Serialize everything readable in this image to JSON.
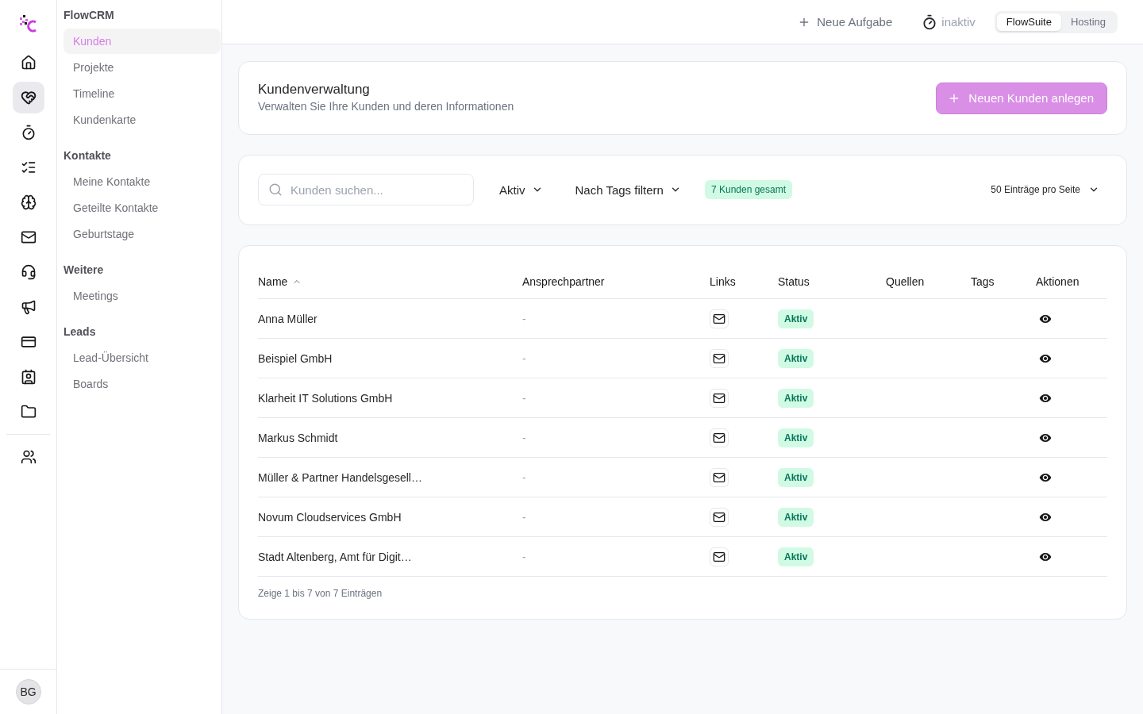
{
  "rail": {
    "items": [
      {
        "kind": "home",
        "selected": false
      },
      {
        "kind": "partners",
        "selected": true
      },
      {
        "kind": "time",
        "selected": false
      },
      {
        "kind": "tasks",
        "selected": false
      },
      {
        "kind": "ideas",
        "selected": false
      },
      {
        "kind": "mail",
        "selected": false
      },
      {
        "kind": "support",
        "selected": false
      },
      {
        "kind": "marketing",
        "selected": false
      },
      {
        "kind": "billing",
        "selected": false
      },
      {
        "kind": "contacts",
        "selected": false
      },
      {
        "kind": "files",
        "selected": false
      }
    ],
    "bottom_items": [
      {
        "kind": "team",
        "selected": false
      }
    ],
    "avatar": {
      "initials": "BG"
    }
  },
  "sidebar": {
    "sections": [
      {
        "heading": "FlowCRM",
        "items": [
          {
            "label": "Kunden",
            "selected": true
          },
          {
            "label": "Projekte",
            "selected": false
          },
          {
            "label": "Timeline",
            "selected": false
          },
          {
            "label": "Kundenkarte",
            "selected": false
          }
        ]
      },
      {
        "heading": "Kontakte",
        "items": [
          {
            "label": "Meine Kontakte",
            "selected": false
          },
          {
            "label": "Geteilte Kontakte",
            "selected": false
          },
          {
            "label": "Geburtstage",
            "selected": false
          }
        ]
      },
      {
        "heading": "Weitere",
        "items": [
          {
            "label": "Meetings",
            "selected": false
          }
        ]
      },
      {
        "heading": "Leads",
        "items": [
          {
            "label": "Lead-Übersicht",
            "selected": false
          },
          {
            "label": "Boards",
            "selected": false
          }
        ]
      }
    ]
  },
  "topbar": {
    "new_task": "Neue Aufgabe",
    "timer_status": "inaktiv",
    "workspaces": [
      {
        "label": "FlowSuite",
        "selected": true
      },
      {
        "label": "Hosting",
        "selected": false
      }
    ]
  },
  "header": {
    "title": "Kundenverwaltung",
    "subtitle": "Verwalten Sie Ihre Kunden und deren Informationen",
    "button": "Neuen Kunden anlegen"
  },
  "filters": {
    "search": {
      "placeholder": "Kunden suchen..."
    },
    "status_filter": "Aktiv",
    "tag_filter": "Nach Tags filtern",
    "count": "7 Kunden gesamt",
    "page_size": "50 Einträge pro Seite"
  },
  "table": {
    "columns": [
      {
        "label": "Name",
        "sorted": true
      },
      {
        "label": "Ansprechpartner",
        "sorted": false
      },
      {
        "label": "Links",
        "sorted": false
      },
      {
        "label": "Status",
        "sorted": false
      },
      {
        "label": "Quellen",
        "sorted": false
      },
      {
        "label": "Tags",
        "sorted": false
      },
      {
        "label": "Aktionen",
        "sorted": false
      }
    ],
    "rows": [
      {
        "name": "Anna Müller",
        "contact": "-",
        "links": [
          {
            "kind": "email"
          }
        ],
        "status": "Aktiv",
        "actions": [
          {
            "kind": "view"
          }
        ]
      },
      {
        "name": "Beispiel GmbH",
        "contact": "-",
        "links": [
          {
            "kind": "email"
          }
        ],
        "status": "Aktiv",
        "actions": [
          {
            "kind": "view"
          }
        ]
      },
      {
        "name": "Klarheit IT Solutions GmbH",
        "contact": "-",
        "links": [
          {
            "kind": "email"
          }
        ],
        "status": "Aktiv",
        "actions": [
          {
            "kind": "view"
          }
        ]
      },
      {
        "name": "Markus Schmidt",
        "contact": "-",
        "links": [
          {
            "kind": "email"
          }
        ],
        "status": "Aktiv",
        "actions": [
          {
            "kind": "view"
          }
        ]
      },
      {
        "name": "Müller & Partner Handelsgesell…",
        "contact": "-",
        "links": [
          {
            "kind": "email"
          }
        ],
        "status": "Aktiv",
        "actions": [
          {
            "kind": "view"
          }
        ]
      },
      {
        "name": "Novum Cloudservices GmbH",
        "contact": "-",
        "links": [
          {
            "kind": "email"
          }
        ],
        "status": "Aktiv",
        "actions": [
          {
            "kind": "view"
          }
        ]
      },
      {
        "name": "Stadt Altenberg, Amt für Digit…",
        "contact": "-",
        "links": [
          {
            "kind": "email"
          }
        ],
        "status": "Aktiv",
        "actions": [
          {
            "kind": "view"
          }
        ]
      }
    ],
    "footer": "Zeige 1 bis 7 von 7 Einträgen"
  }
}
